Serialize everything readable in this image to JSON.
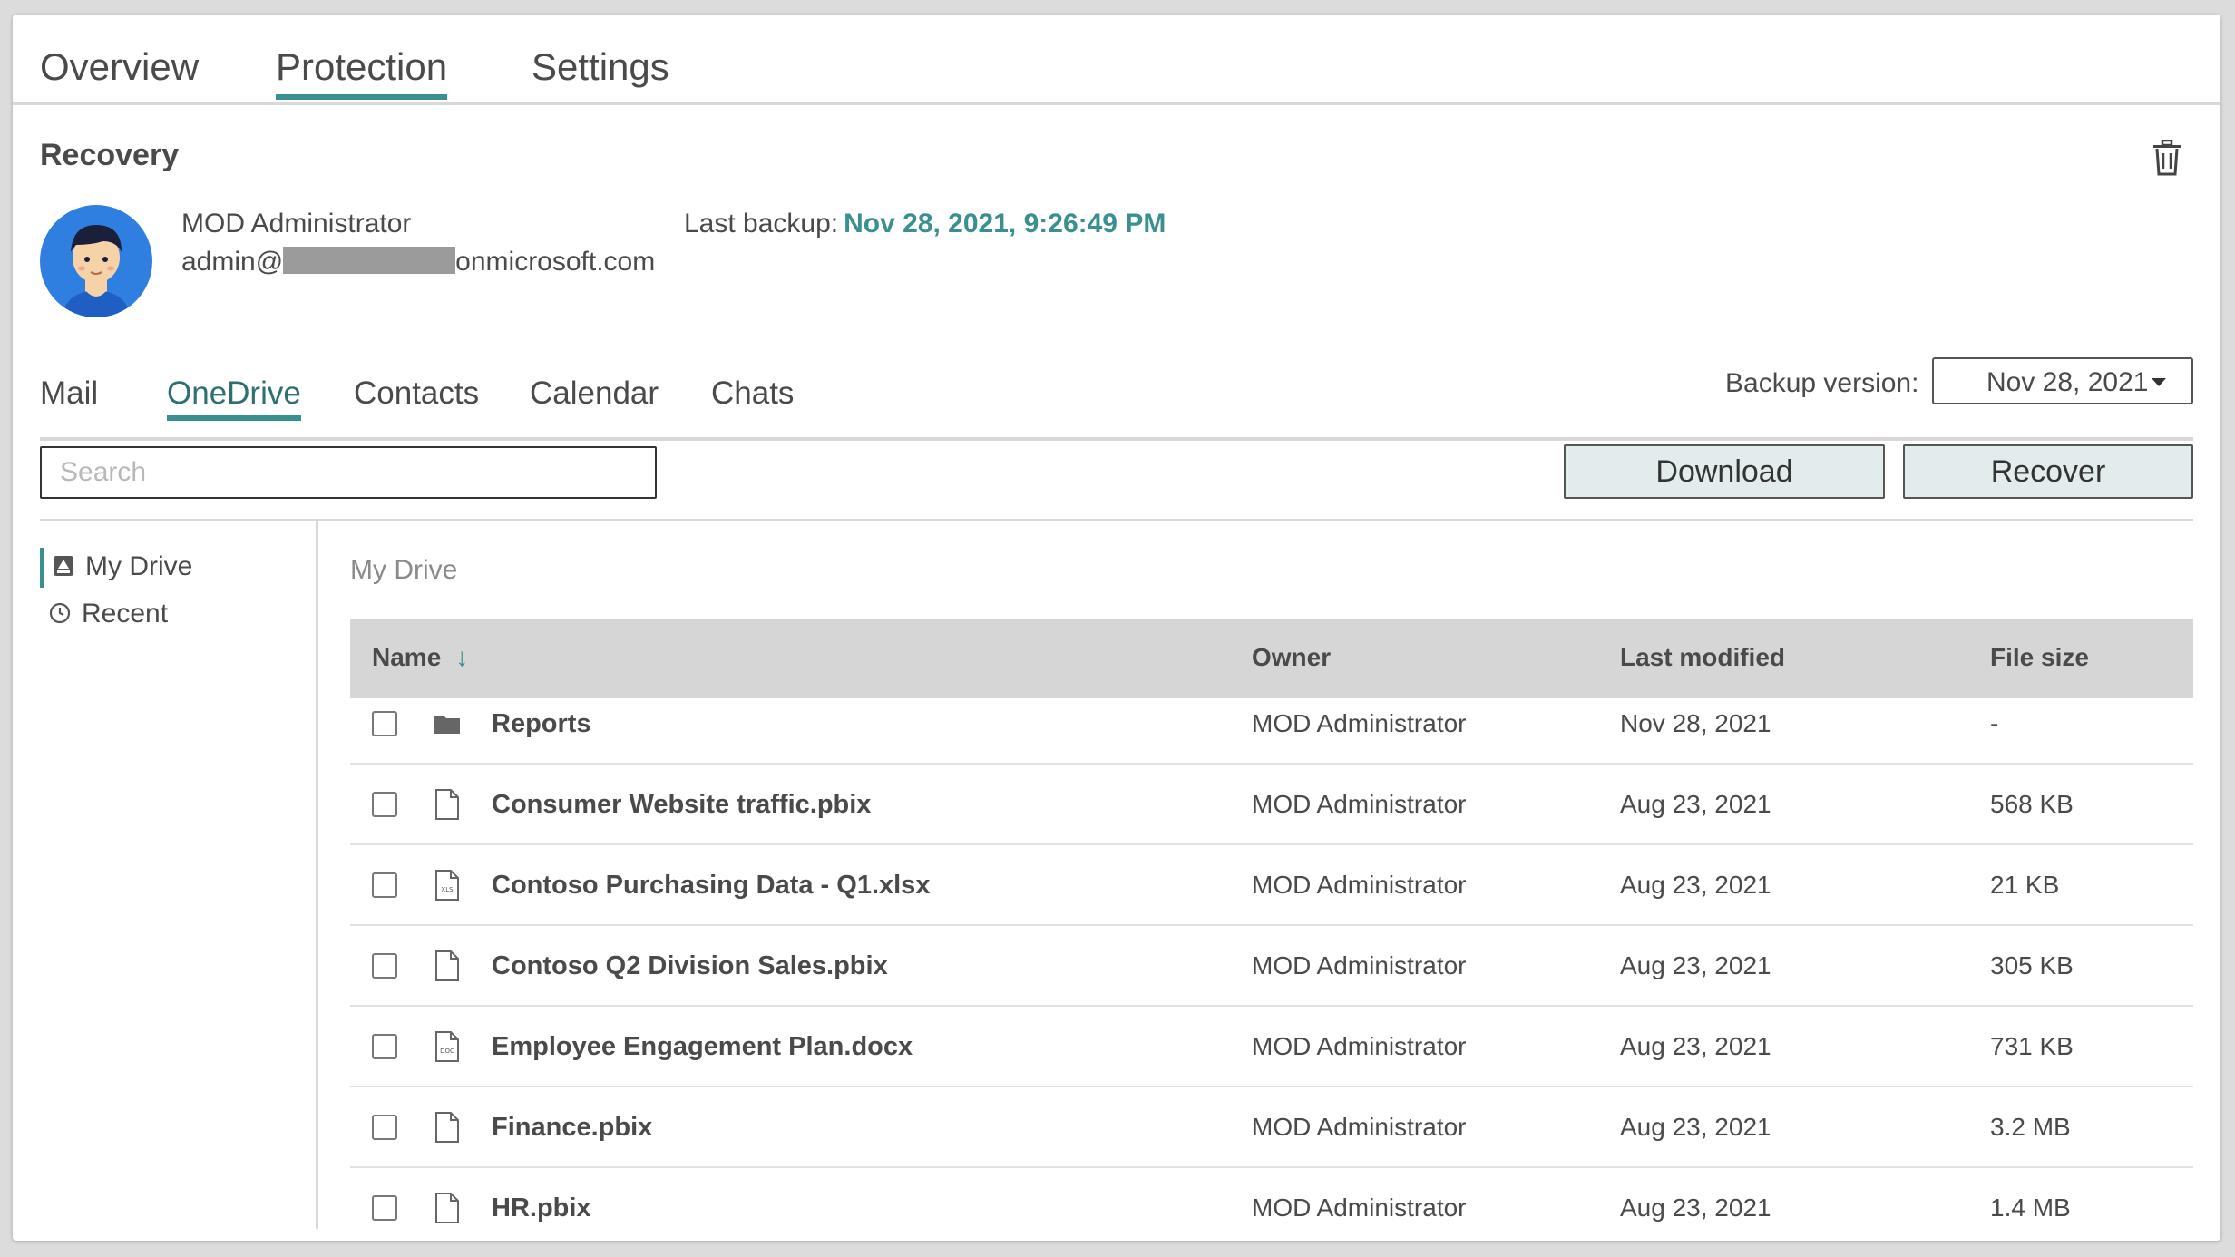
{
  "top_tabs": [
    "Overview",
    "Protection",
    "Settings"
  ],
  "active_top_tab": "Protection",
  "recovery": {
    "title": "Recovery",
    "user_name": "MOD Administrator",
    "email_prefix": "admin@",
    "email_suffix": "onmicrosoft.com",
    "last_backup_label": "Last backup:",
    "last_backup_value": "Nov 28, 2021, 9:26:49 PM"
  },
  "sub_tabs": [
    "Mail",
    "OneDrive",
    "Contacts",
    "Calendar",
    "Chats"
  ],
  "active_sub_tab": "OneDrive",
  "backup_version": {
    "label": "Backup version:",
    "selected": "Nov 28, 2021"
  },
  "search": {
    "placeholder": "Search",
    "value": ""
  },
  "buttons": {
    "download": "Download",
    "recover": "Recover"
  },
  "sidebar": [
    {
      "label": "My Drive",
      "icon": "drive-icon",
      "active": true
    },
    {
      "label": "Recent",
      "icon": "clock-icon",
      "active": false
    }
  ],
  "breadcrumb": "My Drive",
  "table": {
    "columns": [
      "Name",
      "Owner",
      "Last modified",
      "File size"
    ],
    "sort_icon": "arrow-down-icon",
    "rows": [
      {
        "name": "Reports",
        "icon": "folder-icon",
        "owner": "MOD Administrator",
        "modified": "Nov 28, 2021",
        "size": "-"
      },
      {
        "name": "Consumer Website traffic.pbix",
        "icon": "file-icon",
        "owner": "MOD Administrator",
        "modified": "Aug 23, 2021",
        "size": "568 KB"
      },
      {
        "name": "Contoso Purchasing Data - Q1.xlsx",
        "icon": "xls-file-icon",
        "owner": "MOD Administrator",
        "modified": "Aug 23, 2021",
        "size": "21 KB"
      },
      {
        "name": "Contoso Q2 Division Sales.pbix",
        "icon": "file-icon",
        "owner": "MOD Administrator",
        "modified": "Aug 23, 2021",
        "size": "305 KB"
      },
      {
        "name": "Employee Engagement Plan.docx",
        "icon": "doc-file-icon",
        "owner": "MOD Administrator",
        "modified": "Aug 23, 2021",
        "size": "731 KB"
      },
      {
        "name": "Finance.pbix",
        "icon": "file-icon",
        "owner": "MOD Administrator",
        "modified": "Aug 23, 2021",
        "size": "3.2 MB"
      },
      {
        "name": "HR.pbix",
        "icon": "file-icon",
        "owner": "MOD Administrator",
        "modified": "Aug 23, 2021",
        "size": "1.4 MB"
      }
    ]
  },
  "colors": {
    "accent": "#3a8f90",
    "header_bg": "#d6d6d6",
    "button_bg": "#e2ecec",
    "avatar_bg": "#2f7fe0"
  }
}
